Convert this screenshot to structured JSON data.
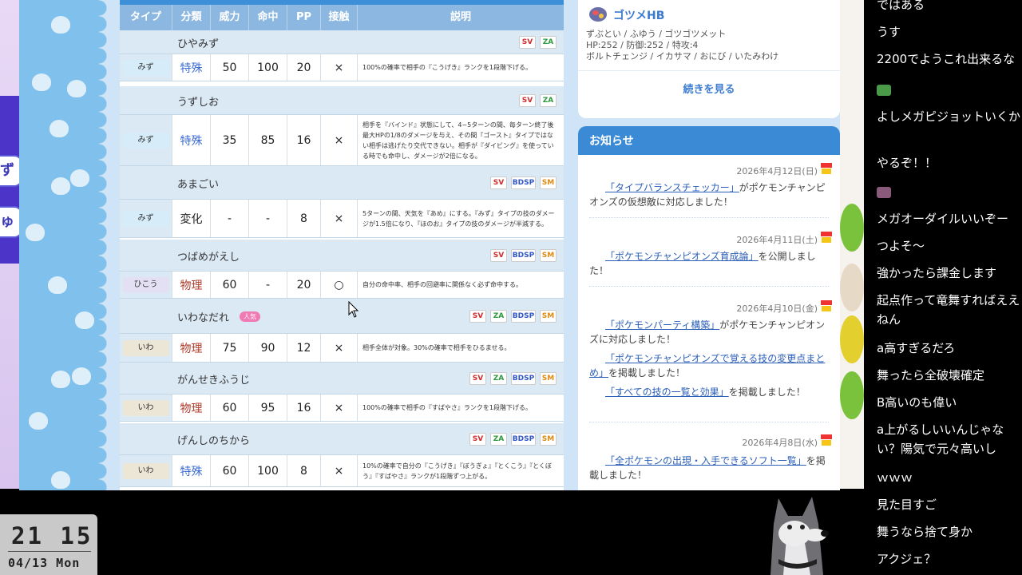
{
  "table": {
    "headers": [
      "タイプ",
      "分類",
      "威力",
      "命中",
      "PP",
      "接触",
      "説明"
    ],
    "moves": [
      {
        "name": "ひやみず",
        "badges": [
          "SV",
          "ZA"
        ],
        "popular": "",
        "type": "みず",
        "type_color": "#d6ecf8",
        "category": "特殊",
        "category_class": "cls-tokushu",
        "power": "50",
        "accuracy": "100",
        "pp": "20",
        "contact": "×",
        "desc": "100%の確率で相手の『こうげき』ランクを1段階下げる。"
      },
      {
        "name": "うずしお",
        "badges": [
          "SV",
          "ZA"
        ],
        "popular": "",
        "type": "みず",
        "type_color": "#d6ecf8",
        "category": "特殊",
        "category_class": "cls-tokushu",
        "power": "35",
        "accuracy": "85",
        "pp": "16",
        "contact": "×",
        "desc": "相手を『バインド』状態にして、4~5ターンの間、毎ターン終了後最大HPの1/8のダメージを与え、その間『ゴースト』タイプではない相手は逃げたり交代できない。相手が『ダイビング』を使っている時でも命中し、ダメージが2倍になる。"
      },
      {
        "name": "あまごい",
        "badges": [
          "SV",
          "BDSP",
          "SM"
        ],
        "popular": "",
        "type": "みず",
        "type_color": "#d6ecf8",
        "category": "変化",
        "category_class": "cls-henka",
        "power": "-",
        "accuracy": "-",
        "pp": "8",
        "contact": "×",
        "desc": "5ターンの間、天気を『あめ』にする。『みず』タイプの技のダメージが1.5倍になり、『ほのお』タイプの技のダメージが半減する。"
      },
      {
        "name": "つばめがえし",
        "badges": [
          "SV",
          "BDSP",
          "SM"
        ],
        "popular": "",
        "type": "ひこう",
        "type_color": "#e3e0f3",
        "category": "物理",
        "category_class": "cls-butsuri",
        "power": "60",
        "accuracy": "-",
        "pp": "20",
        "contact": "○",
        "desc": "自分の命中率、相手の回避率に関係なく必ず命中する。"
      },
      {
        "name": "いわなだれ",
        "badges": [
          "SV",
          "ZA",
          "BDSP",
          "SM"
        ],
        "popular": "人気",
        "type": "いわ",
        "type_color": "#ece6d6",
        "category": "物理",
        "category_class": "cls-butsuri",
        "power": "75",
        "accuracy": "90",
        "pp": "12",
        "contact": "×",
        "desc": "相手全体が対象。30%の確率で相手をひるませる。"
      },
      {
        "name": "がんせきふうじ",
        "badges": [
          "SV",
          "ZA",
          "BDSP",
          "SM"
        ],
        "popular": "",
        "type": "いわ",
        "type_color": "#ece6d6",
        "category": "物理",
        "category_class": "cls-butsuri",
        "power": "60",
        "accuracy": "95",
        "pp": "16",
        "contact": "×",
        "desc": "100%の確率で相手の『すばやさ』ランクを1段階下げる。"
      },
      {
        "name": "げんしのちから",
        "badges": [
          "SV",
          "ZA",
          "BDSP",
          "SM"
        ],
        "popular": "",
        "type": "いわ",
        "type_color": "#ece6d6",
        "category": "特殊",
        "category_class": "cls-tokushu",
        "power": "60",
        "accuracy": "100",
        "pp": "8",
        "contact": "×",
        "desc": "10%の確率で自分の『こうげき』『ぼうぎょ』『とくこう』『とくぼう』『すばやさ』ランクが1段階ずつ上がる。"
      }
    ]
  },
  "pokemon_card": {
    "name": "ゴツメHB",
    "line1": "ずぶとい / ふゆう / ゴツゴツメット",
    "line2": "HP:252 / 防御:252 / 特攻:4",
    "line3": "ボルトチェンジ / イカサマ / おにび / いたみわけ",
    "more": "続きを見る"
  },
  "news": {
    "title": "お知らせ",
    "items": [
      {
        "date": "2026年4月12日(日)",
        "link": "「タイプバランスチェッカー」",
        "rest": "がポケモンチャンピオンズの仮想敵に対応しました！"
      },
      {
        "date": "2026年4月11日(土)",
        "link": "「ポケモンチャンピオンズ育成論」",
        "rest": "を公開しました！"
      },
      {
        "date": "2026年4月10日(金)",
        "link": "「ポケモンパーティ構築」",
        "rest": "がポケモンチャンピオンズに対応しました！",
        "link2": "「ポケモンチャンピオンズで覚える技の変更点まとめ」",
        "rest2": "を掲載しました！",
        "link3": "「すべての技の一覧と効果」",
        "rest3": "を掲載しました！"
      },
      {
        "date": "2026年4月8日(水)",
        "link": "「全ポケモンの出現・入手できるソフト一覧」",
        "rest": "を掲載しました！"
      }
    ]
  },
  "clock": {
    "time": "21 15",
    "date": "04/13 Mon"
  },
  "side_tabs": [
    "ずく",
    "ゅう"
  ],
  "comments": [
    "ではある",
    "うす",
    "2200でようこれ出来るな",
    "",
    "よしメガピジョットいくか",
    "やるぞ！！",
    "",
    "メガオーダイルいいぞー",
    "つよそ～",
    "強かったら課金します",
    "起点作って竜舞すればええねん",
    "a高すぎるだろ",
    "舞ったら全破壊確定",
    "B高いのも偉い",
    "a上がるしいいんじゃない？陽気で元々高いし",
    "ｗｗｗ",
    "見た目すご",
    "舞うなら捨て身か",
    "アクジェ？"
  ],
  "colors": {
    "header_blue": "#3a8ad6",
    "link_blue": "#2c5fb8",
    "accent_purple": "#4b34c7"
  }
}
